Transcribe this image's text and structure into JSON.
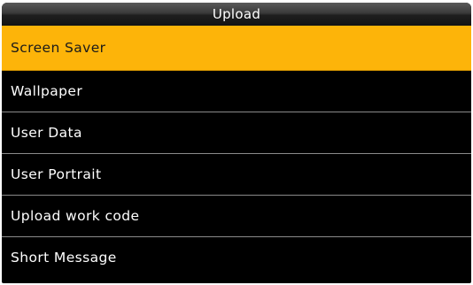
{
  "header": {
    "title": "Upload"
  },
  "menu": {
    "items": [
      {
        "label": "Screen Saver",
        "selected": true
      },
      {
        "label": "Wallpaper",
        "selected": false
      },
      {
        "label": "User Data",
        "selected": false
      },
      {
        "label": "User Portrait",
        "selected": false
      },
      {
        "label": "Upload work code",
        "selected": false
      },
      {
        "label": "Short Message",
        "selected": false
      }
    ]
  },
  "colors": {
    "accent": "#fdb409",
    "background": "#000000",
    "text": "#ffffff"
  }
}
